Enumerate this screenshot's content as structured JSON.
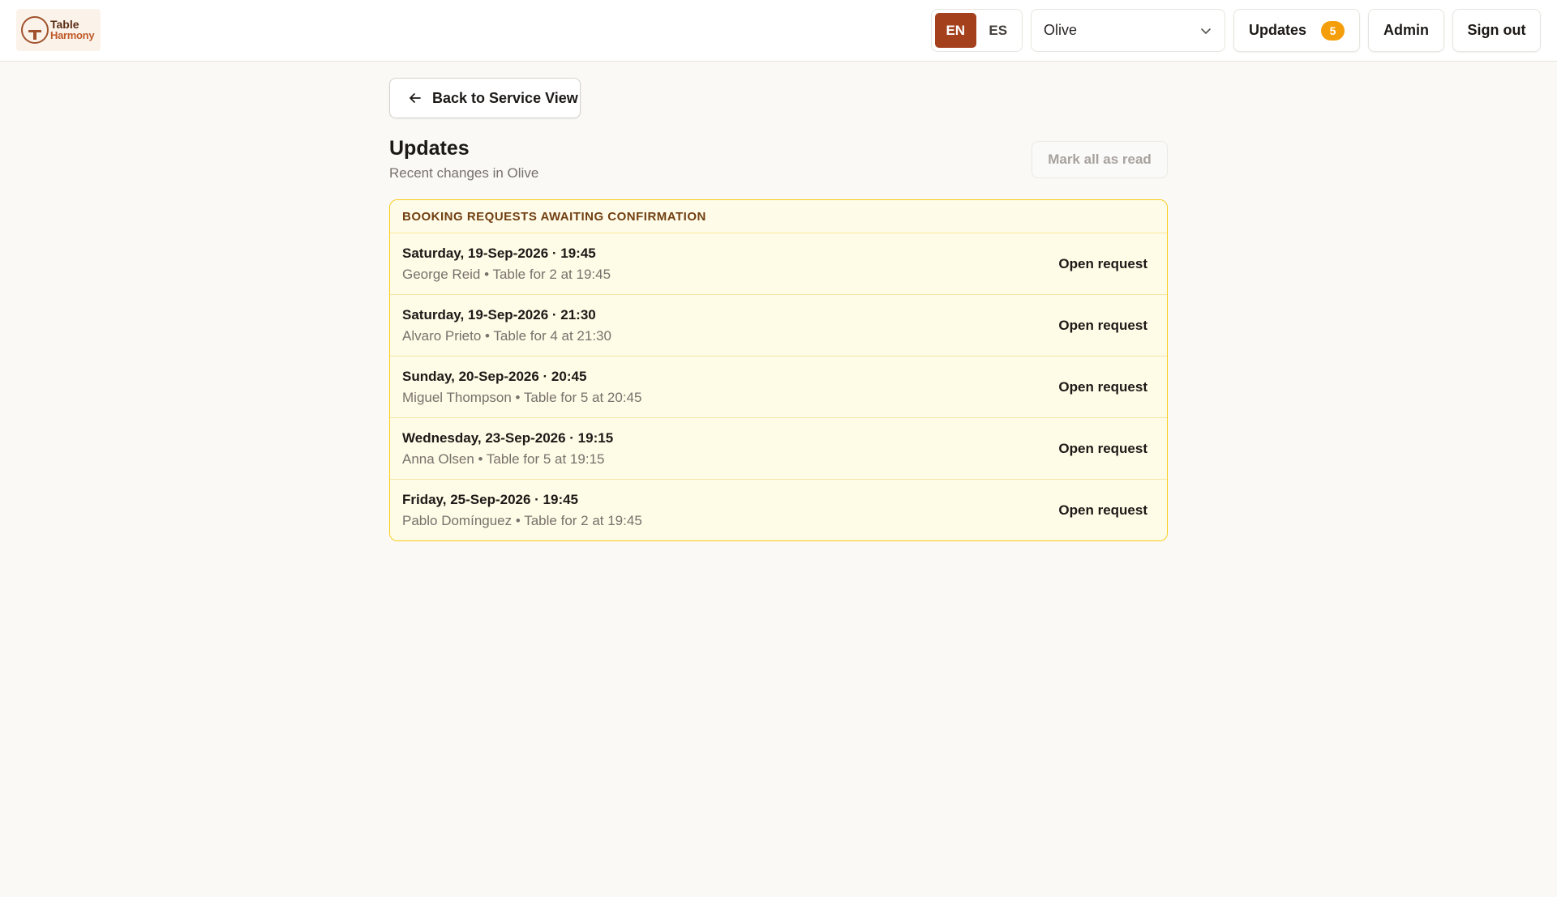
{
  "header": {
    "logo": {
      "line1": "Table",
      "line2": "Harmony"
    },
    "languages": [
      {
        "code": "EN",
        "active": true
      },
      {
        "code": "ES",
        "active": false
      }
    ],
    "venue": {
      "selected": "Olive"
    },
    "updates": {
      "label": "Updates",
      "count": "5"
    },
    "admin_label": "Admin",
    "signout_label": "Sign out"
  },
  "main": {
    "back_label": "Back to Service View",
    "title": "Updates",
    "subtitle": "Recent changes in Olive",
    "mark_all_label": "Mark all as read",
    "section": {
      "heading": "BOOKING REQUESTS AWAITING CONFIRMATION",
      "items": [
        {
          "title": "Saturday, 19-Sep-2026 · 19:45",
          "detail": "George Reid • Table for 2 at 19:45",
          "action": "Open request"
        },
        {
          "title": "Saturday, 19-Sep-2026 · 21:30",
          "detail": "Alvaro Prieto • Table for 4 at 21:30",
          "action": "Open request"
        },
        {
          "title": "Sunday, 20-Sep-2026 · 20:45",
          "detail": "Miguel Thompson • Table for 5 at 20:45",
          "action": "Open request"
        },
        {
          "title": "Wednesday, 23-Sep-2026 · 19:15",
          "detail": "Anna Olsen • Table for 5 at 19:15",
          "action": "Open request"
        },
        {
          "title": "Friday, 25-Sep-2026 · 19:45",
          "detail": "Pablo Domínguez • Table for 2 at 19:45",
          "action": "Open request"
        }
      ]
    }
  },
  "colors": {
    "accent": "#a4401c",
    "badge": "#f59e0b",
    "card_border": "#facc15",
    "card_bg": "#fefce8"
  }
}
